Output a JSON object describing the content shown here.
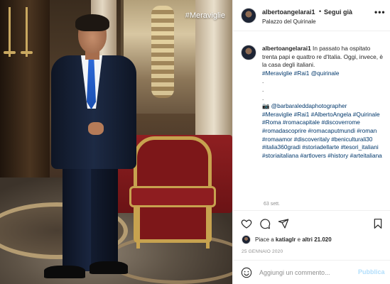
{
  "photo": {
    "overlay_hashtag": "#Meraviglie",
    "alt": "Alberto Angela in Palazzo del Quirinale"
  },
  "header": {
    "username": "albertoangelarai1",
    "separator": "•",
    "follow_label": "Segui già",
    "location": "Palazzo del Quirinale",
    "more_icon": "more-horizontal-icon"
  },
  "caption": {
    "username": "albertoangelarai1",
    "text": "In passato ha ospitato trenta papi e quattro re d'Italia. Oggi, invece, è la casa degli italiani.",
    "hashtags_line1": "#Meraviglie #Rai1 @quirinale",
    "dot1": ".",
    "dot2": ".",
    "dot3": ".",
    "camera_emoji": "📷",
    "credit": "@barbaraleddaphotographer",
    "hashtags_block": "#Meraviglie #Rai1 #AlbertoAngela #Quirinale #Roma #romacapitale #discoverrome #romadascoprire #romacaputmundi #roman #romaamor #discoveritaly #beniculturali30 #italia360gradi #storiadellarte #tesori_italiani #storiaitaliana #artlovers #history #arteitaliana",
    "time_ago": "63 sett."
  },
  "actions": {
    "like_icon": "heart-icon",
    "comment_icon": "comment-icon",
    "share_icon": "share-icon",
    "save_icon": "bookmark-icon"
  },
  "likes": {
    "prefix": "Piace a",
    "user": "katiaglr",
    "middle": "e",
    "count_text": "altri 21.020"
  },
  "post_date": "25 GENNAIO 2020",
  "comment_box": {
    "emoji_icon": "emoji-icon",
    "placeholder": "Aggiungi un commento...",
    "publish_label": "Pubblica"
  },
  "colors": {
    "link": "#00376b",
    "muted": "#8e8e8e",
    "publish_disabled": "#b2dffc",
    "text": "#262626"
  }
}
